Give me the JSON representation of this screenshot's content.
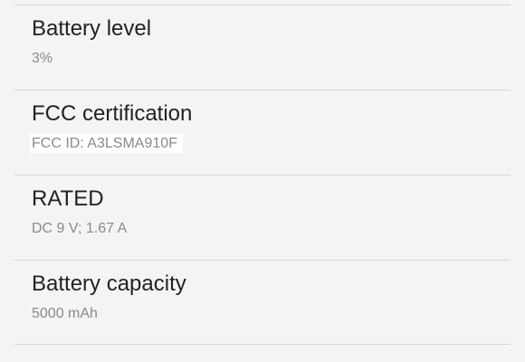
{
  "settings": {
    "items": [
      {
        "title": "Battery level",
        "subtitle": "3%"
      },
      {
        "title": "FCC certification",
        "subtitle": "FCC ID: A3LSMA910F"
      },
      {
        "title": "RATED",
        "subtitle": "DC 9 V; 1.67 A"
      },
      {
        "title": "Battery capacity",
        "subtitle": "5000 mAh"
      }
    ]
  },
  "colors": {
    "background": "#f4f4f4",
    "title": "#222222",
    "subtitle": "#8a8a8a",
    "divider": "#d6d6d6"
  }
}
